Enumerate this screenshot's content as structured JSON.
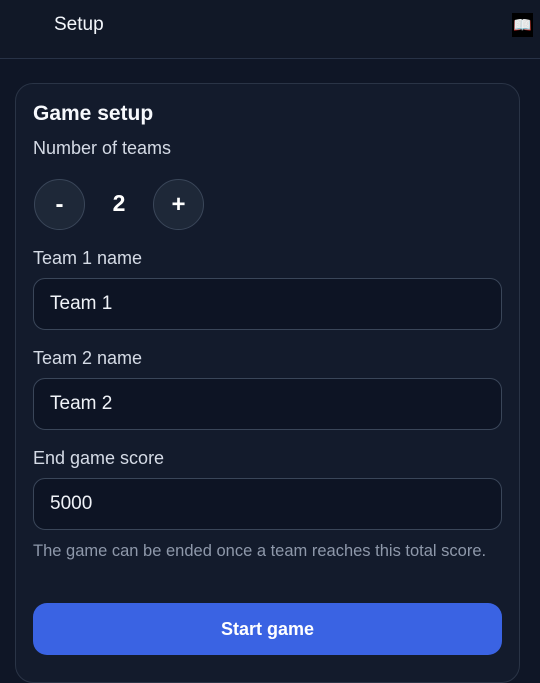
{
  "header": {
    "title": "Setup",
    "book_icon": "📖"
  },
  "setup": {
    "heading": "Game setup",
    "teams_label": "Number of teams",
    "decrement_label": "-",
    "increment_label": "+",
    "team_count": "2",
    "team1_label": "Team 1 name",
    "team1_value": "Team 1",
    "team2_label": "Team 2 name",
    "team2_value": "Team 2",
    "end_score_label": "End game score",
    "end_score_value": "5000",
    "hint": "The game can be ended once a team reaches this total score.",
    "start_button": "Start game"
  },
  "colors": {
    "background": "#0f1626",
    "card": "#131b2c",
    "accent": "#3a63e3"
  }
}
